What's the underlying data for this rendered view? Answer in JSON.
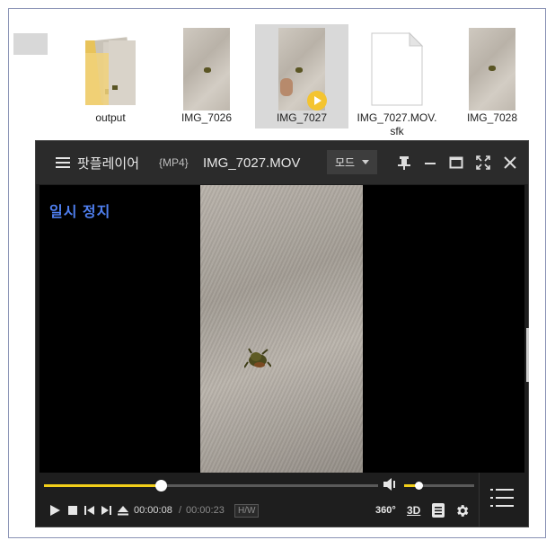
{
  "explorer": {
    "files": [
      {
        "name": "output",
        "type": "folder"
      },
      {
        "name": "IMG_7026",
        "type": "video"
      },
      {
        "name": "IMG_7027",
        "type": "video",
        "selected": true
      },
      {
        "name": "IMG_7027.MOV.\nsfk",
        "type": "document"
      },
      {
        "name": "IMG_7028",
        "type": "video"
      }
    ]
  },
  "player": {
    "brand": "팟플레이어",
    "format": "{MP4}",
    "filename": "IMG_7027.MOV",
    "mode_label": "모드",
    "status_overlay": "일시 정지",
    "time_current": "00:00:08",
    "time_separator": "/",
    "time_total": "00:00:23",
    "hw_label": "H/W",
    "btn_360": "360°",
    "btn_3d": "3D",
    "progress_fraction": 0.35,
    "volume_fraction": 0.2,
    "accent_color": "#f2cf1a",
    "overlay_color": "#4f7ff0"
  }
}
